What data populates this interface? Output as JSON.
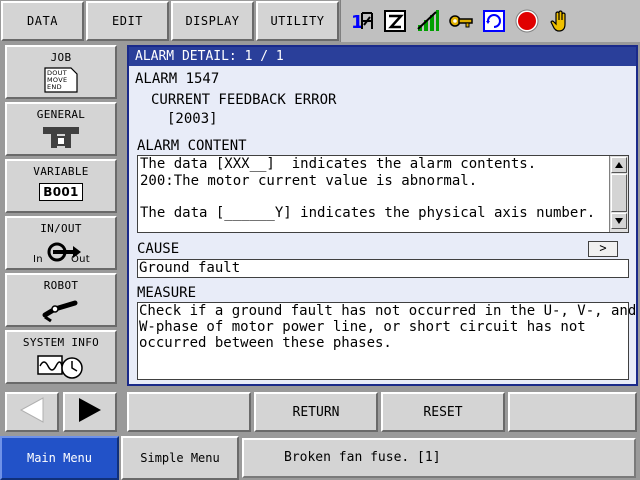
{
  "top_menu": {
    "items": [
      {
        "label": "DATA"
      },
      {
        "label": "EDIT"
      },
      {
        "label": "DISPLAY"
      },
      {
        "label": "UTILITY"
      }
    ]
  },
  "status_icons": [
    {
      "name": "coordinate-axis-icon",
      "color": "#0000ff"
    },
    {
      "name": "edit-page-icon",
      "color": "#000000"
    },
    {
      "name": "signal-level-icon",
      "color": "#00a000"
    },
    {
      "name": "key-icon",
      "color": "#d0a000"
    },
    {
      "name": "cycle-mode-icon",
      "color": "#0000ff"
    },
    {
      "name": "stop-icon",
      "color": "#e00000"
    },
    {
      "name": "hand-icon",
      "color": "#e0b000"
    }
  ],
  "left_nav": {
    "items": [
      {
        "label": "JOB",
        "icon": "job-doc-icon",
        "icon_lines": [
          "DOUT",
          "MOVE",
          "END"
        ]
      },
      {
        "label": "GENERAL",
        "icon": "tool-icon"
      },
      {
        "label": "VARIABLE",
        "icon": "variable-icon",
        "icon_text": "B001"
      },
      {
        "label": "IN/OUT",
        "icon": "in-out-icon",
        "icon_in": "In",
        "icon_out": "Out"
      },
      {
        "label": "ROBOT",
        "icon": "robot-arm-icon"
      },
      {
        "label": "SYSTEM INFO",
        "icon": "system-info-icon"
      }
    ]
  },
  "panel": {
    "title": "ALARM DETAIL: 1 / 1",
    "alarm_number": "ALARM 1547",
    "alarm_name": "CURRENT FEEDBACK ERROR",
    "alarm_sub": "[2003]",
    "content_label": "ALARM CONTENT",
    "content_lines": [
      "The data [XXX__]  indicates the alarm contents.",
      "200:The motor current value is abnormal.",
      "",
      "The data [______Y] indicates the physical axis number."
    ],
    "cause_label": "CAUSE",
    "cause_button": ">",
    "cause_text": "Ground fault",
    "measure_label": "MEASURE",
    "measure_lines": [
      "Check if a ground fault has not occurred in the U-, V-, and",
      "W-phase of motor power line, or short circuit has not",
      "occurred between these phases."
    ]
  },
  "bottom_buttons": {
    "b1": "",
    "return": "RETURN",
    "reset": "RESET",
    "b4": ""
  },
  "footer": {
    "main_menu": "Main Menu",
    "simple_menu": "Simple Menu",
    "message": "Broken fan fuse. [1]"
  },
  "colors": {
    "title_bar": "#2a3f9a",
    "main_menu_active": "#2252c8",
    "panel_bg": "#e8ecf8"
  }
}
